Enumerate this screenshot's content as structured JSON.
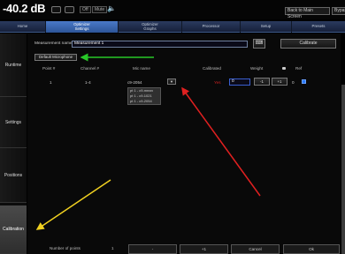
{
  "status": {
    "level": "-40.2 dB",
    "off_label": "Off",
    "mute_label": "Mute",
    "main_screen_label": "Back to Main Screen",
    "bypass_label": "Bypass"
  },
  "tabs": [
    {
      "label_line1": "Home",
      "label_line2": ""
    },
    {
      "label_line1": "Optimizer",
      "label_line2": "Settings"
    },
    {
      "label_line1": "Optimizer",
      "label_line2": "Graphs"
    },
    {
      "label_line1": "Processor",
      "label_line2": ""
    },
    {
      "label_line1": "Setup",
      "label_line2": ""
    },
    {
      "label_line1": "Presets",
      "label_line2": ""
    }
  ],
  "side_tabs": [
    "Runtime",
    "Settings",
    "Positions",
    "Calibration"
  ],
  "measurement": {
    "name_label": "Measurement name",
    "name_value": "Measurement 1",
    "calibrate_label": "Calibrate",
    "default_mic_label": "Default Microphone"
  },
  "table": {
    "headers": {
      "point": "Point #",
      "channel": "Channel #",
      "mic": "Mic name",
      "calibrated": "Calibrated",
      "weight": "Weight",
      "ref": "Ref"
    },
    "row": {
      "point": "1",
      "channel": "1-4",
      "mic": "c9-2054",
      "calibrated": "Yes",
      "weight": "0",
      "minus": "-1",
      "plus": "+1",
      "val": "0"
    },
    "dropdown_options": [
      "pt 1 - c9-mean",
      "pt 1 - c9-1021",
      "pt 1 - c9-2054"
    ]
  },
  "bottom": {
    "points_label": "Number of points",
    "points_value": "1",
    "minus": "-",
    "plus": "+1",
    "cancel": "Cancel",
    "ok": "Ok"
  },
  "colors": {
    "accent_tab": "#3a67b5",
    "calibrated_yes": "#cc2222",
    "arrow_red": "#e02020",
    "arrow_green": "#28c828",
    "arrow_yellow": "#f0d020"
  }
}
